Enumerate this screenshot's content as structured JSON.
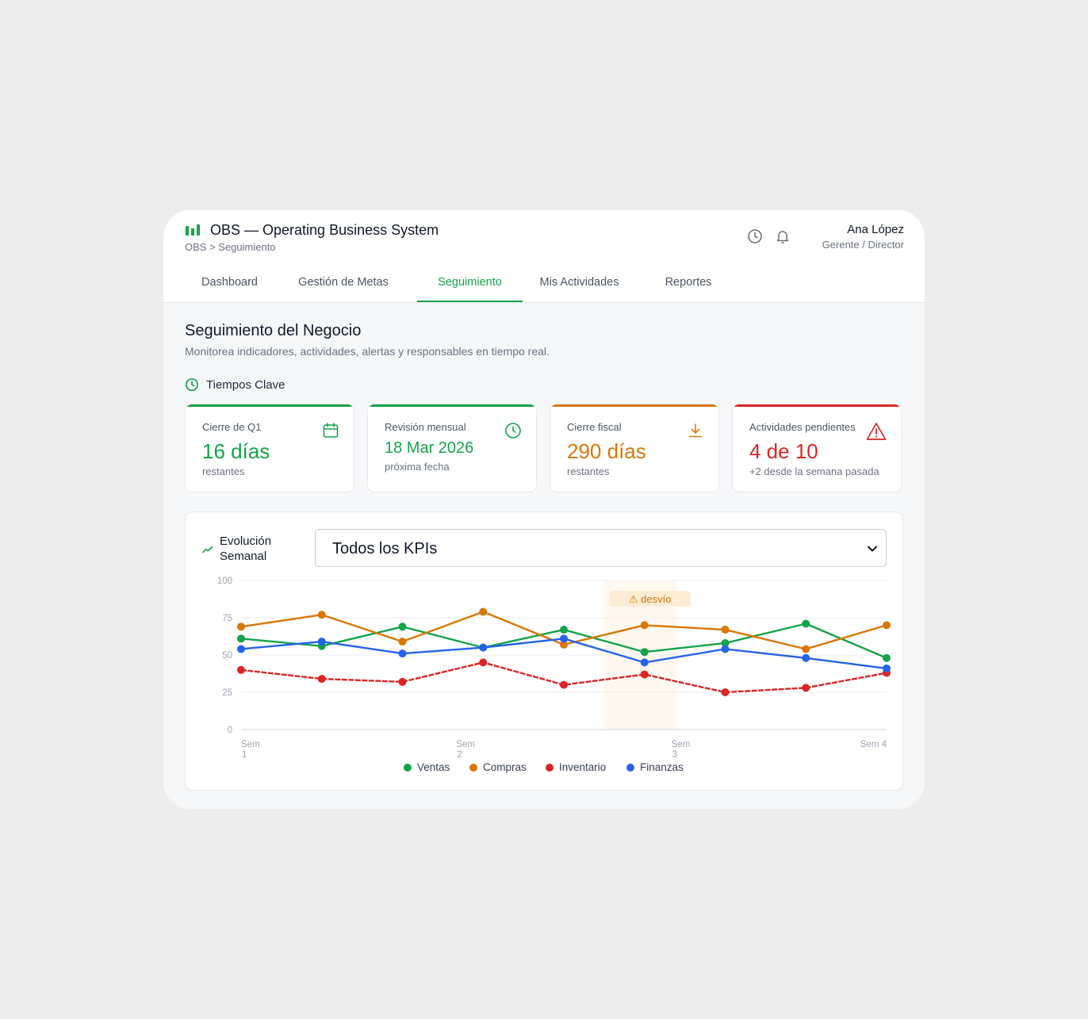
{
  "header": {
    "title": "OBS — Operating Business System",
    "breadcrumb": "OBS > Seguimiento",
    "icons": [
      "clock-icon",
      "bell-icon"
    ],
    "user": {
      "name": "Ana López",
      "role": "Gerente / Director"
    }
  },
  "tabs": [
    {
      "label": "Dashboard",
      "active": false
    },
    {
      "label": "Gestión de Metas",
      "active": false
    },
    {
      "label": "Seguimiento",
      "active": true
    },
    {
      "label": "Mis Actividades",
      "active": false
    },
    {
      "label": "Reportes",
      "active": false
    }
  ],
  "page": {
    "title": "Seguimiento del Negocio",
    "subtitle": "Monitorea indicadores, actividades, alertas y responsables en tiempo real."
  },
  "key_times": {
    "label": "Tiempos Clave",
    "cards": [
      {
        "label": "Cierre de Q1",
        "value": "16 días",
        "note": "restantes",
        "icon": "calendar-icon",
        "color": "#16a34a"
      },
      {
        "label": "Revisión mensual",
        "value": "18 Mar 2026",
        "note": "próxima fecha",
        "icon": "clock-icon",
        "color": "#16a34a"
      },
      {
        "label": "Cierre fiscal",
        "value": "290 días",
        "note": "restantes",
        "icon": "download-icon",
        "color": "#d97706"
      },
      {
        "label": "Actividades pendientes",
        "value": "4 de 10",
        "note": "+2 desde la semana pasada",
        "icon": "alert-triangle-icon",
        "color": "#dc2626"
      }
    ]
  },
  "weekly": {
    "title": "Evolución Semanal",
    "select_value": "Todos los KPIs"
  },
  "chart_data": {
    "type": "line",
    "title": "",
    "xlabel": "",
    "ylabel": "",
    "ylim": [
      0,
      100
    ],
    "yticks": [
      0,
      25,
      50,
      75,
      100
    ],
    "x_tick_labels": [
      "Sem 1",
      "Sem 2",
      "Sem 3",
      "Sem 4"
    ],
    "points_per_series": 9,
    "annotation": {
      "label": "⚠ desvío",
      "from_index": 4.5,
      "to_index": 5.4
    },
    "grid": true,
    "legend_position": "bottom",
    "series": [
      {
        "name": "Ventas",
        "color": "#16a34a",
        "values": [
          61,
          56,
          69,
          55,
          67,
          52,
          58,
          71,
          48
        ]
      },
      {
        "name": "Compras",
        "color": "#d97706",
        "values": [
          69,
          77,
          59,
          79,
          57,
          70,
          67,
          54,
          70
        ]
      },
      {
        "name": "Inventario",
        "color": "#dc2626",
        "values": [
          40,
          34,
          32,
          45,
          30,
          37,
          25,
          28,
          38
        ]
      },
      {
        "name": "Finanzas",
        "color": "#2563eb",
        "values": [
          54,
          59,
          51,
          55,
          61,
          45,
          54,
          48,
          41
        ]
      }
    ]
  }
}
